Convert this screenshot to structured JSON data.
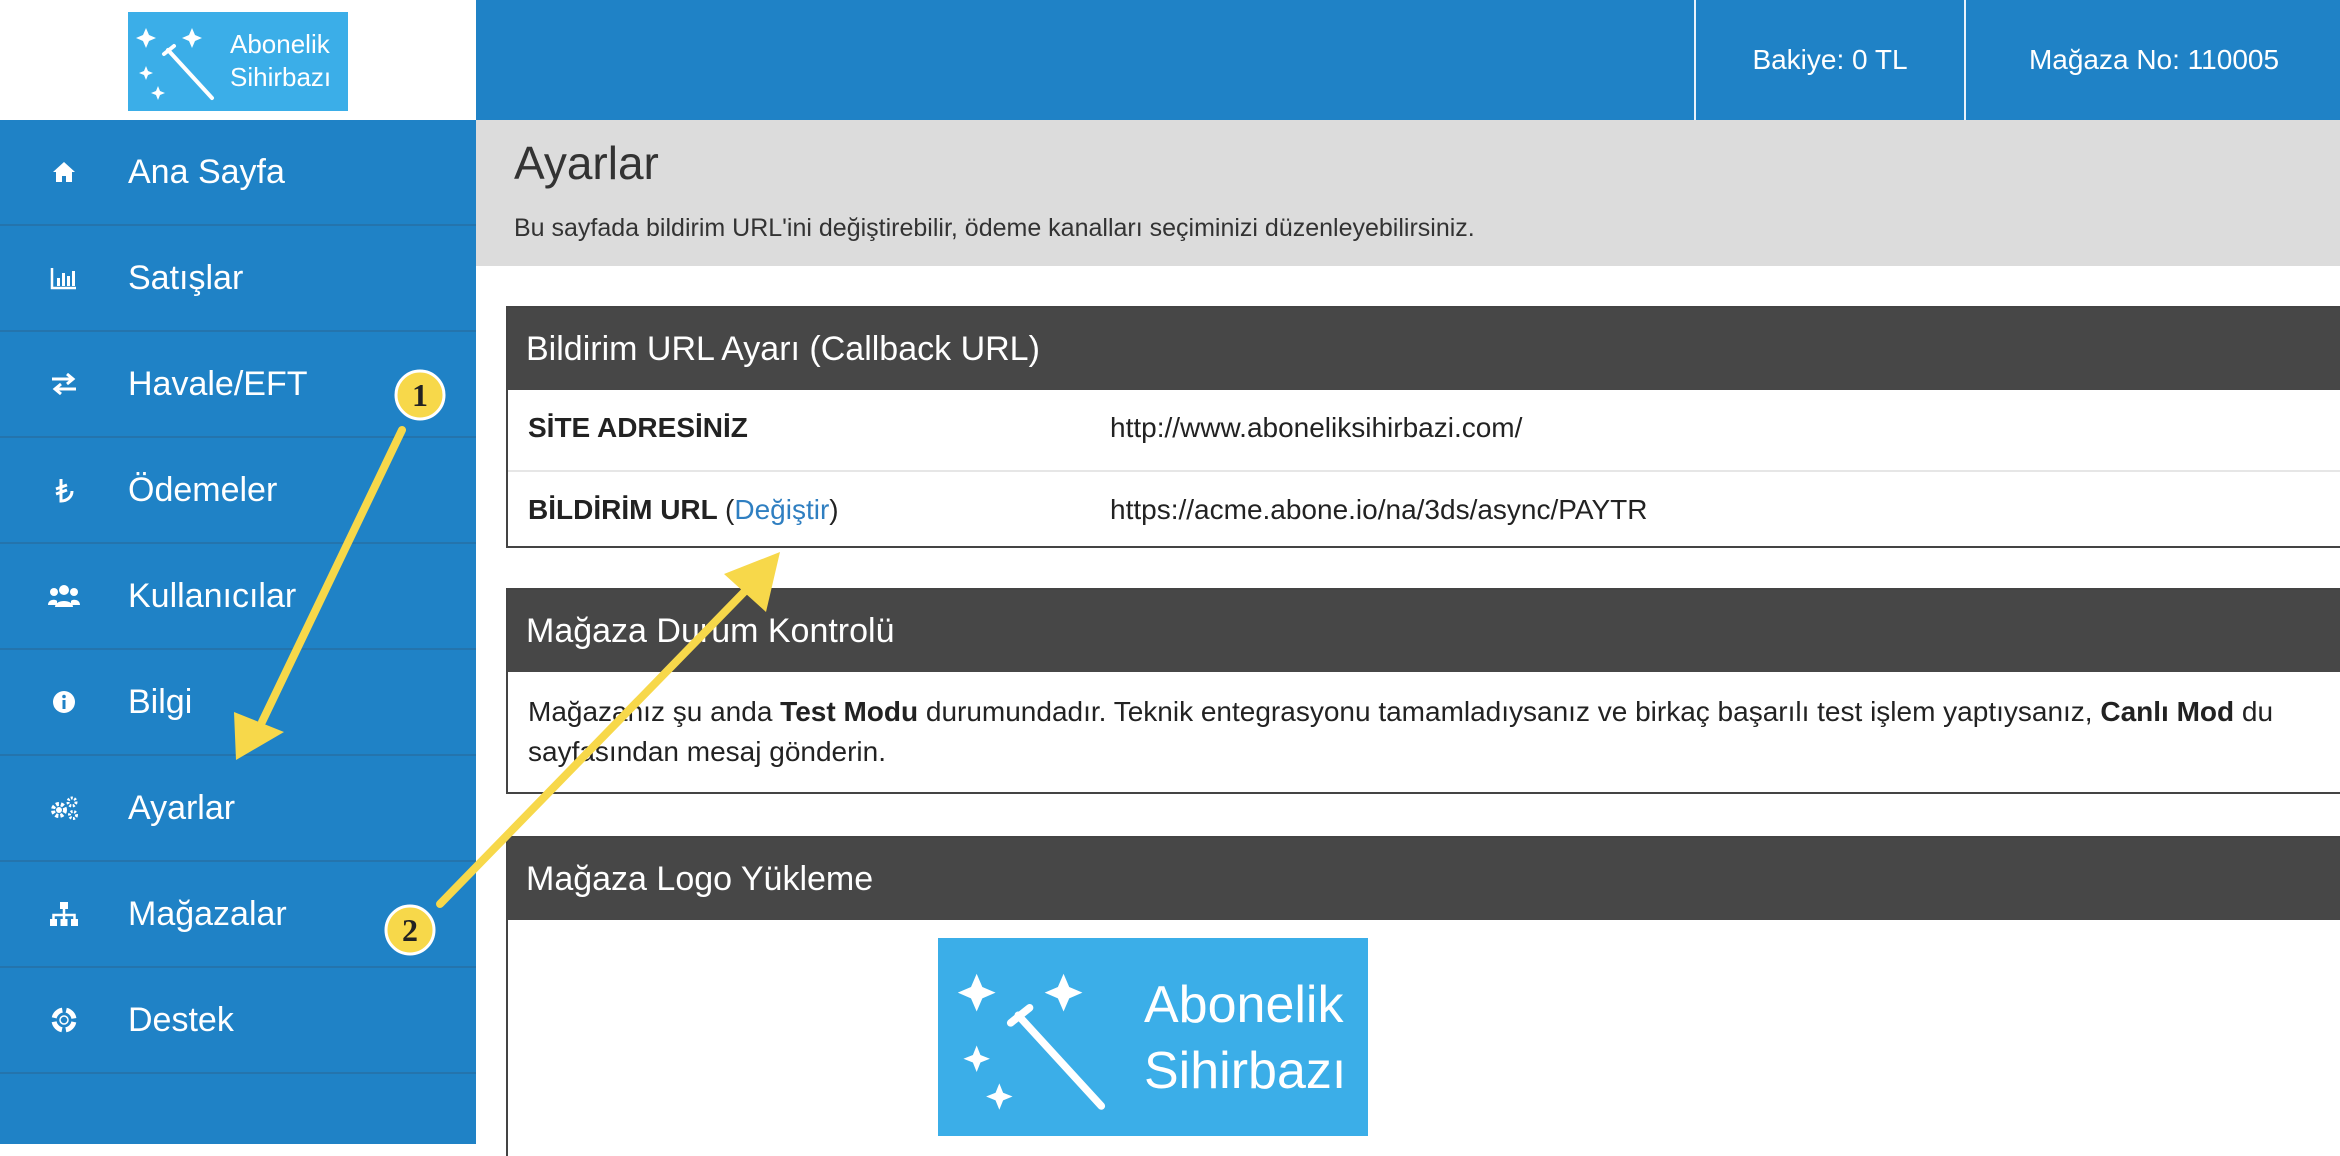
{
  "brand": {
    "line1": "Abonelik",
    "line2": "Sihirbazı",
    "color": "#3baee8"
  },
  "topbar": {
    "balance": "Bakiye: 0 TL",
    "store_no": "Mağaza No: 110005",
    "color": "#1f82c6"
  },
  "sidebar": {
    "items": [
      {
        "label": "Ana Sayfa",
        "icon": "home-icon"
      },
      {
        "label": "Satışlar",
        "icon": "bar-chart-icon"
      },
      {
        "label": "Havale/EFT",
        "icon": "exchange-icon"
      },
      {
        "label": "Ödemeler",
        "icon": "lira-icon"
      },
      {
        "label": "Kullanıcılar",
        "icon": "users-icon"
      },
      {
        "label": "Bilgi",
        "icon": "info-icon"
      },
      {
        "label": "Ayarlar",
        "icon": "gears-icon"
      },
      {
        "label": "Mağazalar",
        "icon": "sitemap-icon"
      },
      {
        "label": "Destek",
        "icon": "lifebuoy-icon"
      }
    ]
  },
  "page": {
    "title": "Ayarlar",
    "description": "Bu sayfada bildirim URL'ini değiştirebilir, ödeme kanalları seçiminizi düzenleyebilirsiniz."
  },
  "callback_panel": {
    "title": "Bildirim URL Ayarı (Callback URL)",
    "site_label": "SİTE ADRESİNİZ",
    "site_value": "http://www.aboneliksihirbazi.com/",
    "notify_label": "BİLDİRİM URL",
    "open_paren": "(",
    "change_link": "Değiştir",
    "close_paren": ")",
    "notify_value": "https://acme.abone.io/na/3ds/async/PAYTR"
  },
  "status_panel": {
    "title": "Mağaza Durum Kontrolü",
    "text_1": "Mağazanız şu anda ",
    "mode_test": "Test Modu",
    "text_2": " durumundadır. Teknik entegrasyonu tamamladıysanız ve birkaç başarılı test işlem yaptıysanız, ",
    "mode_live": "Canlı Mod",
    "text_3": " du",
    "text_4": "sayfasından mesaj gönderin."
  },
  "logo_panel": {
    "title": "Mağaza Logo Yükleme"
  },
  "annotations": {
    "step1": "1",
    "step2": "2",
    "arrow_color": "#f7d84a"
  }
}
